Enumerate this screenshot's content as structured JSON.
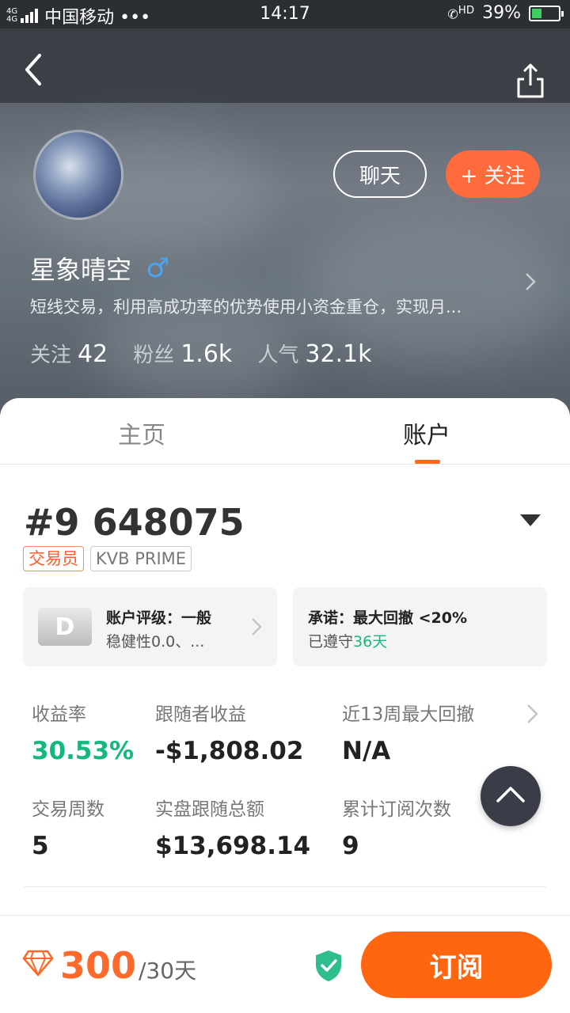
{
  "status_bar": {
    "network_top": "4G",
    "network_bottom": "4G",
    "carrier": "中国移动 •••",
    "time": "14:17",
    "hd_label": "HD",
    "battery": "39%",
    "battery_level": 0.39
  },
  "profile": {
    "name": "星象晴空",
    "gender_symbol": "♂",
    "bio": "短线交易，利用高成功率的优势使用小资金重仓，实现月...",
    "chat_label": "聊天",
    "follow_label": "+ 关注",
    "stats": [
      {
        "label": "关注",
        "value": "42"
      },
      {
        "label": "粉丝",
        "value": "1.6k"
      },
      {
        "label": "人气",
        "value": "32.1k"
      }
    ]
  },
  "tabs": [
    {
      "label": "主页",
      "active": false
    },
    {
      "label": "账户",
      "active": true
    }
  ],
  "account": {
    "number": "#9 648075",
    "role_badge": "交易员",
    "broker_badge": "KVB PRIME",
    "rating": {
      "grade": "D",
      "title": "账户评级：一般",
      "detail": "稳健性0.0、..."
    },
    "promise": {
      "title": "承诺：最大回撤 <20%",
      "kept_prefix": "已遵守",
      "kept_days": "36天"
    },
    "metrics": [
      {
        "label": "收益率",
        "value": "30.53%",
        "highlight": true
      },
      {
        "label": "跟随者收益",
        "value": "-$1,808.02",
        "highlight": false
      },
      {
        "label": "近13周最大回撤",
        "value": "N/A",
        "highlight": false
      },
      {
        "label": "交易周数",
        "value": "5",
        "highlight": false
      },
      {
        "label": "实盘跟随总额",
        "value": "$13,698.14",
        "highlight": false
      },
      {
        "label": "累计订阅次数",
        "value": "9",
        "highlight": false
      }
    ]
  },
  "subscription": {
    "price": "300",
    "period": "/30天",
    "button_label": "订阅"
  },
  "colors": {
    "accent_orange": "#ff660f",
    "positive_green": "#14b87c",
    "male_blue": "#4aa4f0"
  }
}
